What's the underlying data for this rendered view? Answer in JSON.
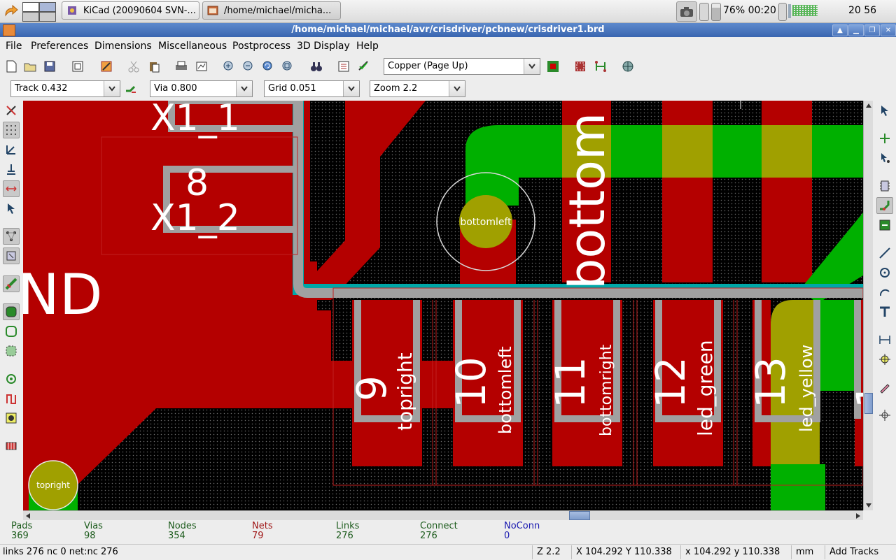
{
  "taskbar": {
    "tasks": [
      {
        "label": "KiCad (20090604 SVN-..."
      },
      {
        "label": "/home/michael/micha..."
      }
    ],
    "battery": "76% 00:20",
    "clock": "20 56"
  },
  "window": {
    "title": "/home/michael/michael/avr/crisdriver/pcbnew/crisdriver1.brd"
  },
  "menu": {
    "items": [
      "File",
      "Preferences",
      "Dimensions",
      "Miscellaneous",
      "Postprocess",
      "3D Display",
      "Help"
    ]
  },
  "toolbar": {
    "layer": "Copper (Page Up)",
    "track": "Track 0.432",
    "via": "Via 0.800",
    "grid": "Grid 0.051",
    "zoom": "Zoom 2.2"
  },
  "board": {
    "refs": {
      "x1_1": "X1_1",
      "pin8": "8",
      "x1_2": "X1_2",
      "gnd": "ND",
      "bottom": "bottom"
    },
    "pads": [
      {
        "num": "9",
        "net": "topright"
      },
      {
        "num": "10",
        "net": "bottomleft"
      },
      {
        "num": "11",
        "net": "bottomright"
      },
      {
        "num": "12",
        "net": "led_green"
      },
      {
        "num": "13",
        "net": "led_yellow"
      },
      {
        "num": "1"
      }
    ],
    "via_labels": {
      "bottomleft": "bottomleft",
      "topright": "topright"
    },
    "colors": {
      "copper_front": "#b40000",
      "copper_back": "#00b000",
      "overlap": "#a0a000",
      "silk": "#ffffff",
      "outline": "#a0a0a0",
      "cyan": "#00a7a7"
    }
  },
  "stats": [
    {
      "label": "Pads",
      "value": "369",
      "color": "#1d5c1d"
    },
    {
      "label": "Vias",
      "value": "98",
      "color": "#1d5c1d"
    },
    {
      "label": "Nodes",
      "value": "354",
      "color": "#1d5c1d"
    },
    {
      "label": "Nets",
      "value": "79",
      "color": "#a01818"
    },
    {
      "label": "Links",
      "value": "276",
      "color": "#1d5c1d"
    },
    {
      "label": "Connect",
      "value": "276",
      "color": "#1d5c1d"
    },
    {
      "label": "NoConn",
      "value": "0",
      "color": "#1818b0"
    }
  ],
  "status": {
    "message": "links 276 nc 0  net:nc 276",
    "zoom": "Z 2.2",
    "abs_coords": "X 104.292  Y 110.338",
    "rel_coords": "x 104.292  y 110.338",
    "units": "mm",
    "mode": "Add Tracks"
  }
}
